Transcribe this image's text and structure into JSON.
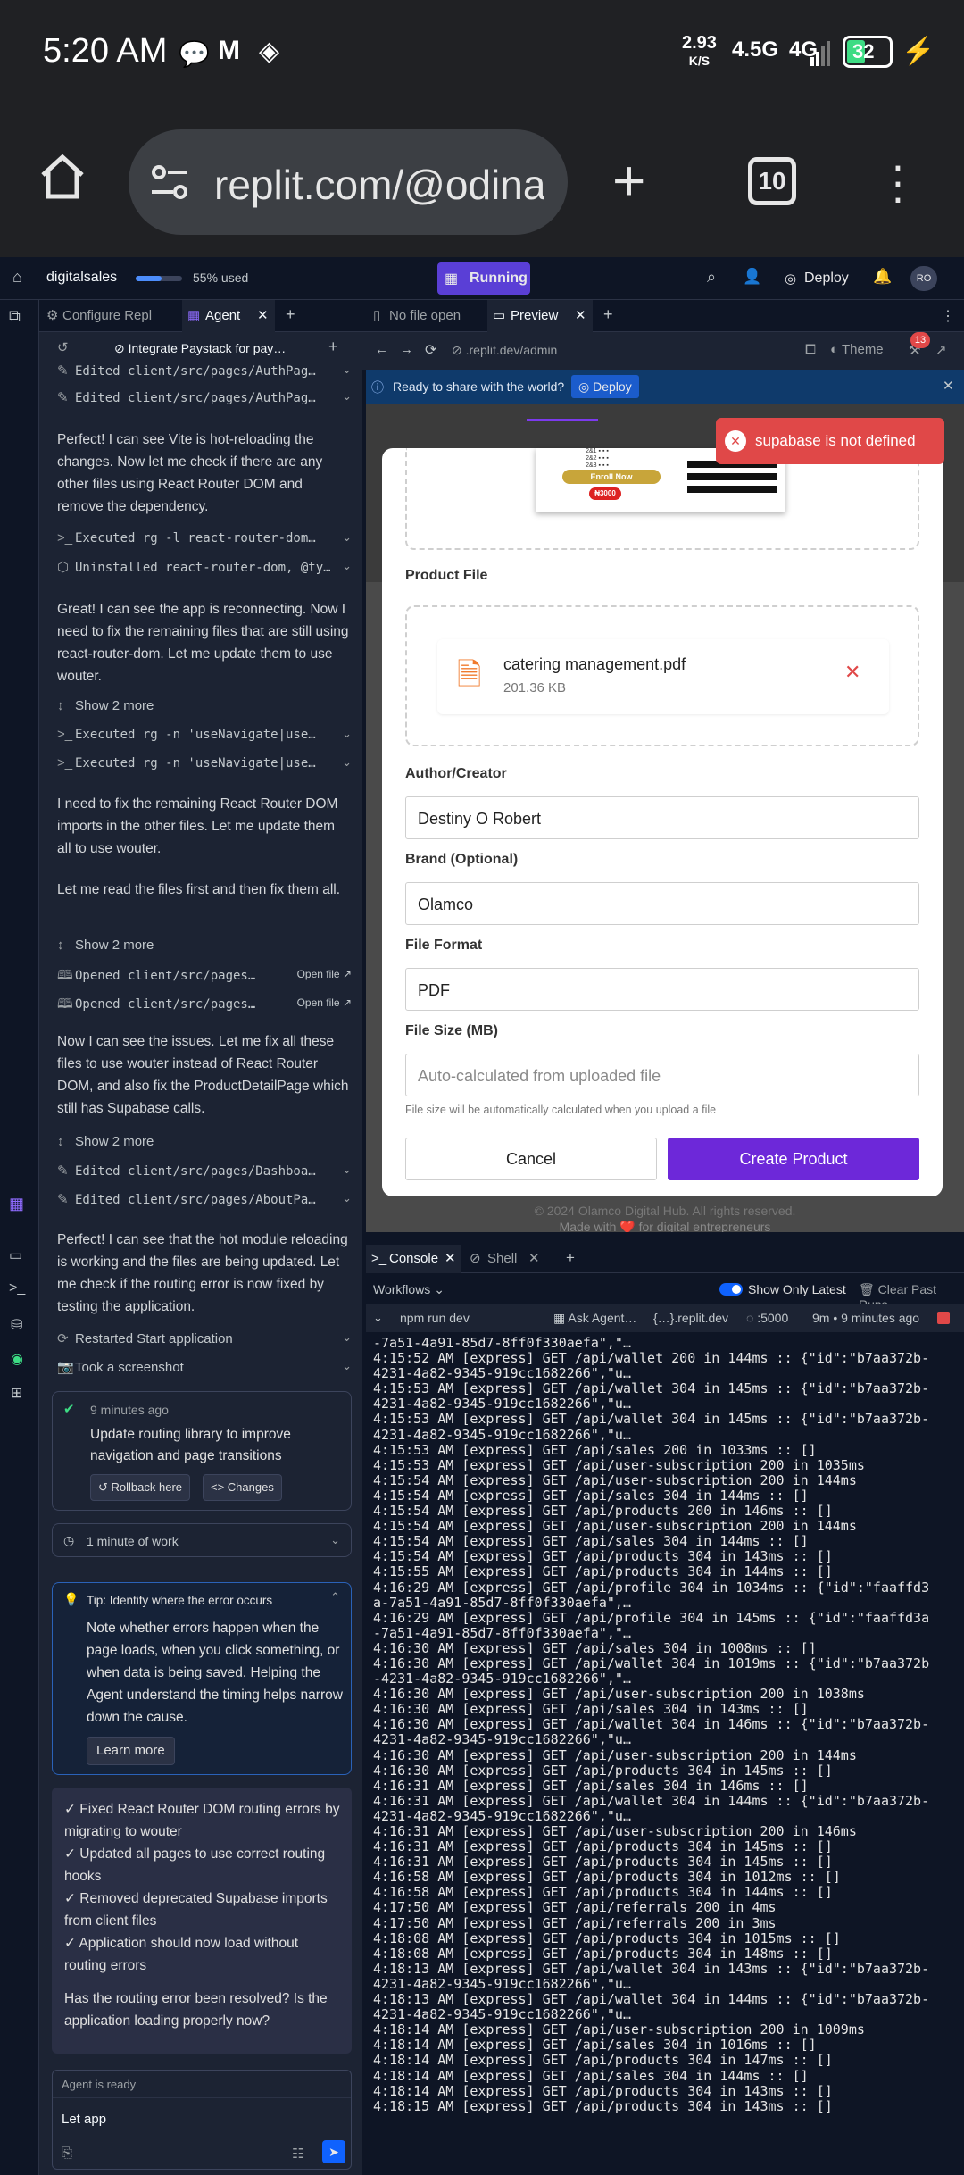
{
  "status_bar": {
    "time": "5:20 AM",
    "net_speed": "2.93",
    "net_unit": "K/S",
    "net1": "4.5G",
    "net2": "4G",
    "battery": "32"
  },
  "browser": {
    "url": "replit.com/@odinaka",
    "tab_count": "10"
  },
  "replit": {
    "project": "digitalsales",
    "usage": "55% used",
    "run_state": "Running",
    "deploy": "Deploy",
    "avatar": "RO"
  },
  "agent_tabs": {
    "configure": "Configure Repl",
    "agent": "Agent"
  },
  "agent_header": "Integrate Paystack for pay…",
  "chat": {
    "edited1": "Edited client/src/pages/AuthPag…",
    "edited2": "Edited client/src/pages/AuthPag…",
    "msg1": "Perfect! I can see Vite is hot-reloading the changes. Now let me check if there are any other files using React Router DOM and remove the dependency.",
    "exec1": "Executed rg -l react-router-dom…",
    "uninstall": "Uninstalled react-router-dom, @ty…",
    "msg2": "Great! I can see the app is reconnecting. Now I need to fix the remaining files that are still using react-router-dom. Let me update them to use wouter.",
    "show_more": "Show 2 more",
    "exec2": "Executed rg -n 'useNavigate|use…",
    "exec3": "Executed rg -n 'useNavigate|use…",
    "msg3": "I need to fix the remaining React Router DOM imports in the other files. Let me update them all to use wouter.",
    "msg4": "Let me read the files first and then fix them all.",
    "opened1": "Opened client/src/pages…",
    "opened2": "Opened client/src/pages…",
    "open_file": "Open file",
    "msg5": "Now I can see the issues. Let me fix all these files to use wouter instead of React Router DOM, and also fix the ProductDetailPage which still has Supabase calls.",
    "edited3": "Edited client/src/pages/Dashboa…",
    "edited4": "Edited client/src/pages/AboutPa…",
    "msg6": "Perfect! I can see that the hot module reloading is working and the files are being updated. Let me check if the routing error is now fixed by testing the application.",
    "restarted": "Restarted Start application",
    "screenshot": "Took a screenshot"
  },
  "checkpoint": {
    "time": "9 minutes ago",
    "title": "Update routing library to improve navigation and page transitions",
    "rollback": "Rollback here",
    "changes": "Changes"
  },
  "work": "1 minute of work",
  "tip": {
    "title": "Tip: Identify where the error occurs",
    "body": "Note whether errors happen when the page loads, when you click something, or when data is being saved. Helping the Agent understand the timing helps narrow down the cause.",
    "learn": "Learn more"
  },
  "summary": {
    "items": [
      "✓ Fixed React Router DOM routing errors by migrating to wouter",
      "✓ Updated all pages to use correct routing hooks",
      "✓ Removed deprecated Supabase imports from client files",
      "✓ Application should now load without routing errors"
    ],
    "question": "Has the routing error been resolved? Is the application loading properly now?"
  },
  "input": {
    "status": "Agent is ready",
    "value": "Let app"
  },
  "web_tabs": {
    "nofile": "No file open",
    "preview": "Preview"
  },
  "nav": {
    "url": ".replit.dev/admin",
    "theme": "Theme",
    "badge": "13"
  },
  "banner": {
    "text": "Ready to share with the world?",
    "deploy": "Deploy"
  },
  "toast": "supabase is not defined",
  "form": {
    "enroll": "Enroll Now",
    "price": "₦3000",
    "product_file_label": "Product File",
    "file_name": "catering management.pdf",
    "file_size": "201.36 KB",
    "author_label": "Author/Creator",
    "author_value": "Destiny O Robert",
    "brand_label": "Brand (Optional)",
    "brand_value": "Olamco",
    "format_label": "File Format",
    "format_value": "PDF",
    "size_label": "File Size (MB)",
    "size_placeholder": "Auto-calculated from uploaded file",
    "size_hint": "File size will be automatically calculated when you upload a file",
    "cancel": "Cancel",
    "create": "Create Product"
  },
  "footer": {
    "copyright": "© 2024 Olamco Digital Hub. All rights reserved.",
    "made": "Made with ❤️ for digital entrepreneurs"
  },
  "console_tabs": {
    "console": "Console",
    "shell": "Shell"
  },
  "workflows": {
    "label": "Workflows",
    "toggle": "Show Only Latest",
    "clear": "Clear Past Runs"
  },
  "run": {
    "cmd": "npm run dev",
    "ask": "Ask Agent…",
    "domain": "{…}.replit.dev",
    "port": ":5000",
    "time": "9m • 9 minutes ago"
  },
  "log": [
    "-7a51-4a91-85d7-8ff0f330aefa\",\"…",
    "4:15:52 AM [express] GET /api/wallet 200 in 144ms :: {\"id\":\"b7aa372b-",
    "4231-4a82-9345-919cc1682266\",\"u…",
    "4:15:53 AM [express] GET /api/wallet 304 in 145ms :: {\"id\":\"b7aa372b-",
    "4231-4a82-9345-919cc1682266\",\"u…",
    "4:15:53 AM [express] GET /api/wallet 304 in 145ms :: {\"id\":\"b7aa372b-",
    "4231-4a82-9345-919cc1682266\",\"u…",
    "4:15:53 AM [express] GET /api/sales 200 in 1033ms :: []",
    "4:15:53 AM [express] GET /api/user-subscription 200 in 1035ms",
    "4:15:54 AM [express] GET /api/user-subscription 200 in 144ms",
    "4:15:54 AM [express] GET /api/sales 304 in 144ms :: []",
    "4:15:54 AM [express] GET /api/products 200 in 146ms :: []",
    "4:15:54 AM [express] GET /api/user-subscription 200 in 144ms",
    "4:15:54 AM [express] GET /api/sales 304 in 144ms :: []",
    "4:15:54 AM [express] GET /api/products 304 in 143ms :: []",
    "4:15:55 AM [express] GET /api/products 304 in 144ms :: []",
    "4:16:29 AM [express] GET /api/profile 304 in 1034ms :: {\"id\":\"faaffd3",
    "a-7a51-4a91-85d7-8ff0f330aefa\",…",
    "4:16:29 AM [express] GET /api/profile 304 in 145ms :: {\"id\":\"faaffd3a",
    "-7a51-4a91-85d7-8ff0f330aefa\",\"…",
    "4:16:30 AM [express] GET /api/sales 304 in 1008ms :: []",
    "4:16:30 AM [express] GET /api/wallet 304 in 1019ms :: {\"id\":\"b7aa372b",
    "-4231-4a82-9345-919cc1682266\",\"…",
    "4:16:30 AM [express] GET /api/user-subscription 200 in 1038ms",
    "4:16:30 AM [express] GET /api/sales 304 in 143ms :: []",
    "4:16:30 AM [express] GET /api/wallet 304 in 146ms :: {\"id\":\"b7aa372b-",
    "4231-4a82-9345-919cc1682266\",\"u…",
    "4:16:30 AM [express] GET /api/user-subscription 200 in 144ms",
    "4:16:30 AM [express] GET /api/products 304 in 145ms :: []",
    "4:16:31 AM [express] GET /api/sales 304 in 146ms :: []",
    "4:16:31 AM [express] GET /api/wallet 304 in 144ms :: {\"id\":\"b7aa372b-",
    "4231-4a82-9345-919cc1682266\",\"u…",
    "4:16:31 AM [express] GET /api/user-subscription 200 in 146ms",
    "4:16:31 AM [express] GET /api/products 304 in 145ms :: []",
    "4:16:31 AM [express] GET /api/products 304 in 145ms :: []",
    "4:16:58 AM [express] GET /api/products 304 in 1012ms :: []",
    "4:16:58 AM [express] GET /api/products 304 in 144ms :: []",
    "4:17:50 AM [express] GET /api/referrals 200 in 4ms",
    "4:17:50 AM [express] GET /api/referrals 200 in 3ms",
    "4:18:08 AM [express] GET /api/products 304 in 1015ms :: []",
    "4:18:08 AM [express] GET /api/products 304 in 148ms :: []",
    "4:18:13 AM [express] GET /api/wallet 304 in 143ms :: {\"id\":\"b7aa372b-",
    "4231-4a82-9345-919cc1682266\",\"u…",
    "4:18:13 AM [express] GET /api/wallet 304 in 144ms :: {\"id\":\"b7aa372b-",
    "4231-4a82-9345-919cc1682266\",\"u…",
    "4:18:14 AM [express] GET /api/user-subscription 200 in 1009ms",
    "4:18:14 AM [express] GET /api/sales 304 in 1016ms :: []",
    "4:18:14 AM [express] GET /api/products 304 in 147ms :: []",
    "4:18:14 AM [express] GET /api/sales 304 in 144ms :: []",
    "4:18:14 AM [express] GET /api/products 304 in 143ms :: []",
    "4:18:15 AM [express] GET /api/products 304 in 143ms :: []"
  ],
  "colors": {
    "accent": "#7c3aed",
    "running": "#5a3fd6",
    "error": "#e04848",
    "bg": "#0e1525"
  }
}
